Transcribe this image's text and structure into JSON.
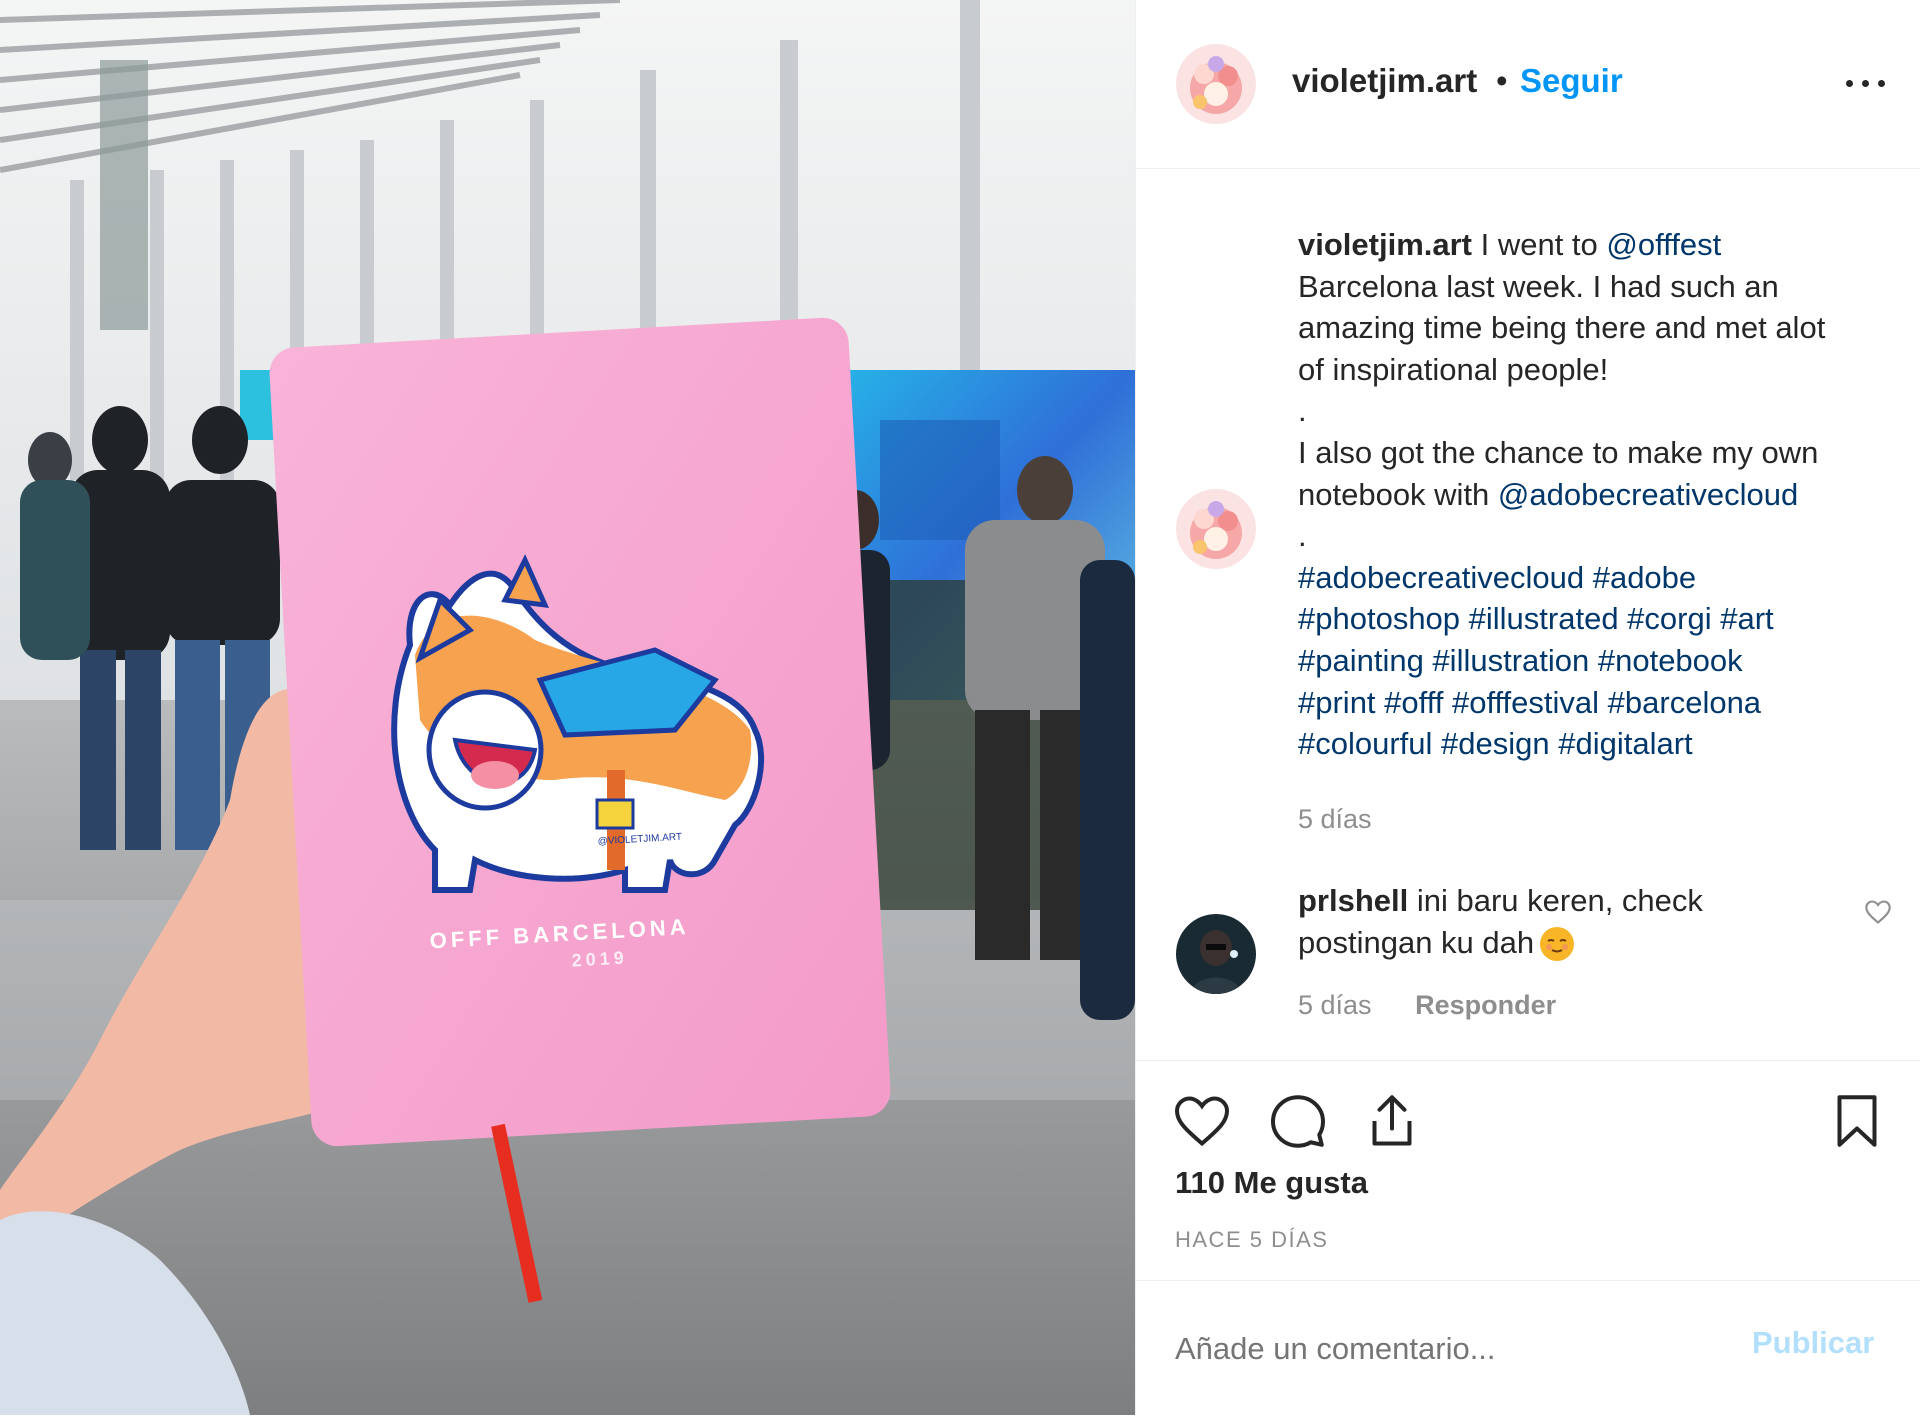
{
  "post": {
    "username": "violetjim.art",
    "separator": "•",
    "follow_label": "Seguir",
    "photo": {
      "notebook_title": "OFFF BARCELONA",
      "notebook_year": "2019",
      "sticker_credit": "@VIOLETJIM.ART"
    },
    "caption": {
      "username": "violetjim.art",
      "lines": [
        {
          "pre": " I went to ",
          "mention": "@offfest"
        },
        {
          "text": "Barcelona last week. I had such an"
        },
        {
          "text": "amazing time being there and met alot"
        },
        {
          "text": "of inspirational people!"
        },
        {
          "text": "."
        },
        {
          "text": "I also got the chance to make my own"
        },
        {
          "pre": "notebook with ",
          "mention": "@adobecreativecloud"
        },
        {
          "text": "."
        }
      ],
      "hashtag_lines": [
        "#adobecreativecloud #adobe",
        "#photoshop #illustrated #corgi #art",
        "#painting #illustration #notebook",
        "#print #offf #offfestival #barcelona",
        "#colourful #design #digitalart"
      ],
      "time": "5 días"
    },
    "comment": {
      "username": "prlshell",
      "text_line1": " ini baru keren, check",
      "text_line2": "postingan ku dah",
      "time": "5 días",
      "reply_label": "Responder"
    },
    "likes": "110 Me gusta",
    "posted_ago": "HACE 5 DÍAS",
    "add_comment": {
      "placeholder": "Añade un comentario...",
      "post_label": "Publicar"
    },
    "icons": {
      "more": "more-options-icon",
      "like": "heart-icon",
      "comment": "comment-bubble-icon",
      "share": "share-icon",
      "save": "bookmark-icon",
      "comment_like": "small-heart-icon"
    },
    "colors": {
      "link_blue": "#0095f6",
      "mention": "#00376b",
      "muted": "#8e8e8e",
      "notebook_pink": "#f7a6d0"
    }
  }
}
